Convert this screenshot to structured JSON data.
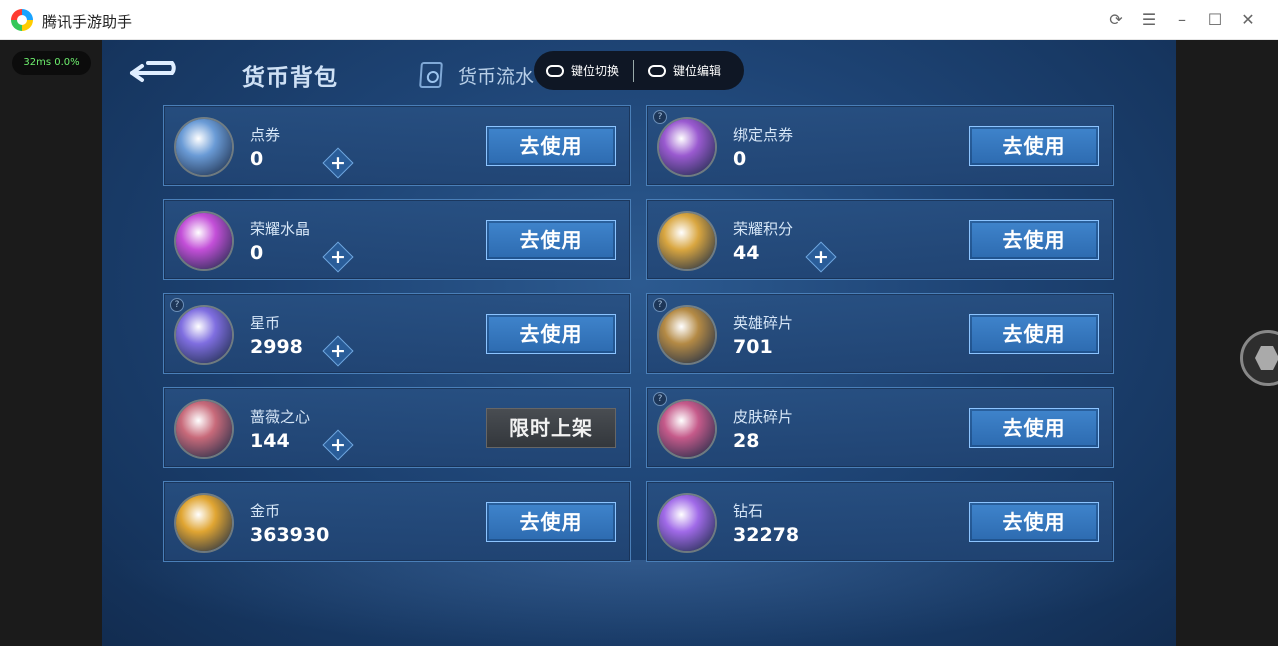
{
  "window": {
    "title": "腾讯手游助手",
    "controls": [
      "refresh-icon",
      "menu-icon",
      "minimize-icon",
      "maximize-icon",
      "close-icon"
    ]
  },
  "status": {
    "latency": "32ms  0.0%"
  },
  "game": {
    "tabs": {
      "wallet": "货币背包",
      "flow": "货币流水"
    },
    "keypill": {
      "switch_label": "键位切换",
      "edit_label": "键位编辑"
    }
  },
  "cards": [
    {
      "name": "点券",
      "value": "0",
      "button": "去使用",
      "plus": true,
      "help": false,
      "icon": "voucher-icon",
      "color": "#6a9bd6"
    },
    {
      "name": "绑定点券",
      "value": "0",
      "button": "去使用",
      "plus": false,
      "help": true,
      "icon": "bound-voucher-icon",
      "color": "#9a5ad0"
    },
    {
      "name": "荣耀水晶",
      "value": "0",
      "button": "去使用",
      "plus": true,
      "help": false,
      "icon": "glory-crystal-icon",
      "color": "#c34fd8"
    },
    {
      "name": "荣耀积分",
      "value": "44",
      "button": "去使用",
      "plus": true,
      "help": false,
      "icon": "glory-points-icon",
      "color": "#d9a640"
    },
    {
      "name": "星币",
      "value": "2998",
      "button": "去使用",
      "plus": true,
      "help": true,
      "icon": "star-coin-icon",
      "color": "#7f6ee0"
    },
    {
      "name": "英雄碎片",
      "value": "701",
      "button": "去使用",
      "plus": false,
      "help": true,
      "icon": "hero-shard-icon",
      "color": "#b48a45"
    },
    {
      "name": "蔷薇之心",
      "value": "144",
      "button": "限时上架",
      "plus": true,
      "help": false,
      "icon": "rose-heart-icon",
      "color": "#c86a7a",
      "button_dark": true
    },
    {
      "name": "皮肤碎片",
      "value": "28",
      "button": "去使用",
      "plus": false,
      "help": true,
      "icon": "skin-shard-icon",
      "color": "#c55a8a"
    },
    {
      "name": "金币",
      "value": "363930",
      "button": "去使用",
      "plus": false,
      "help": false,
      "icon": "gold-coin-icon",
      "color": "#e0a532"
    },
    {
      "name": "钻石",
      "value": "32278",
      "button": "去使用",
      "plus": false,
      "help": false,
      "icon": "diamond-icon",
      "color": "#a06ae8"
    }
  ]
}
